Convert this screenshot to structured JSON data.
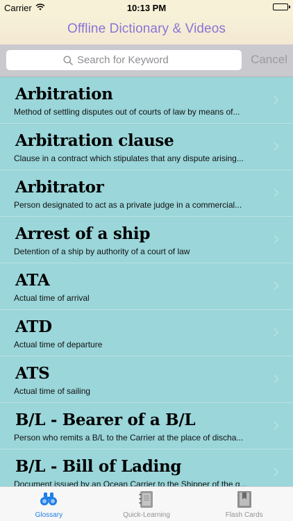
{
  "status_bar": {
    "carrier": "Carrier",
    "time": "10:13 PM"
  },
  "nav": {
    "title": "Offline Dictionary & Videos"
  },
  "search": {
    "placeholder": "Search for Keyword",
    "value": "",
    "cancel_label": "Cancel"
  },
  "entries": [
    {
      "term": "Arbitration",
      "definition": "Method of settling disputes out of courts of law by means of..."
    },
    {
      "term": "Arbitration clause",
      "definition": "Clause in a contract which stipulates that any dispute arising..."
    },
    {
      "term": "Arbitrator",
      "definition": "Person designated to act as a private judge in a commercial..."
    },
    {
      "term": "Arrest of a ship",
      "definition": "Detention of a ship by authority of a court of law"
    },
    {
      "term": "ATA",
      "definition": "Actual time of arrival"
    },
    {
      "term": "ATD",
      "definition": "Actual time of departure"
    },
    {
      "term": "ATS",
      "definition": "Actual time of sailing"
    },
    {
      "term": "B/L - Bearer of a B/L",
      "definition": "Person who remits a B/L  to the Carrier at the place of discha..."
    },
    {
      "term": "B/L - Bill of Lading",
      "definition": "Document issued by an Ocean Carrier to the Shipper of the g..."
    }
  ],
  "tabs": [
    {
      "label": "Glossary",
      "icon": "binoculars-icon",
      "active": true
    },
    {
      "label": "Quick-Learning",
      "icon": "notebook-icon",
      "active": false
    },
    {
      "label": "Flash Cards",
      "icon": "bookmark-book-icon",
      "active": false
    }
  ],
  "colors": {
    "accent": "#1f7ee8",
    "title": "#8a74d6",
    "list_bg": "#9ad6da"
  }
}
